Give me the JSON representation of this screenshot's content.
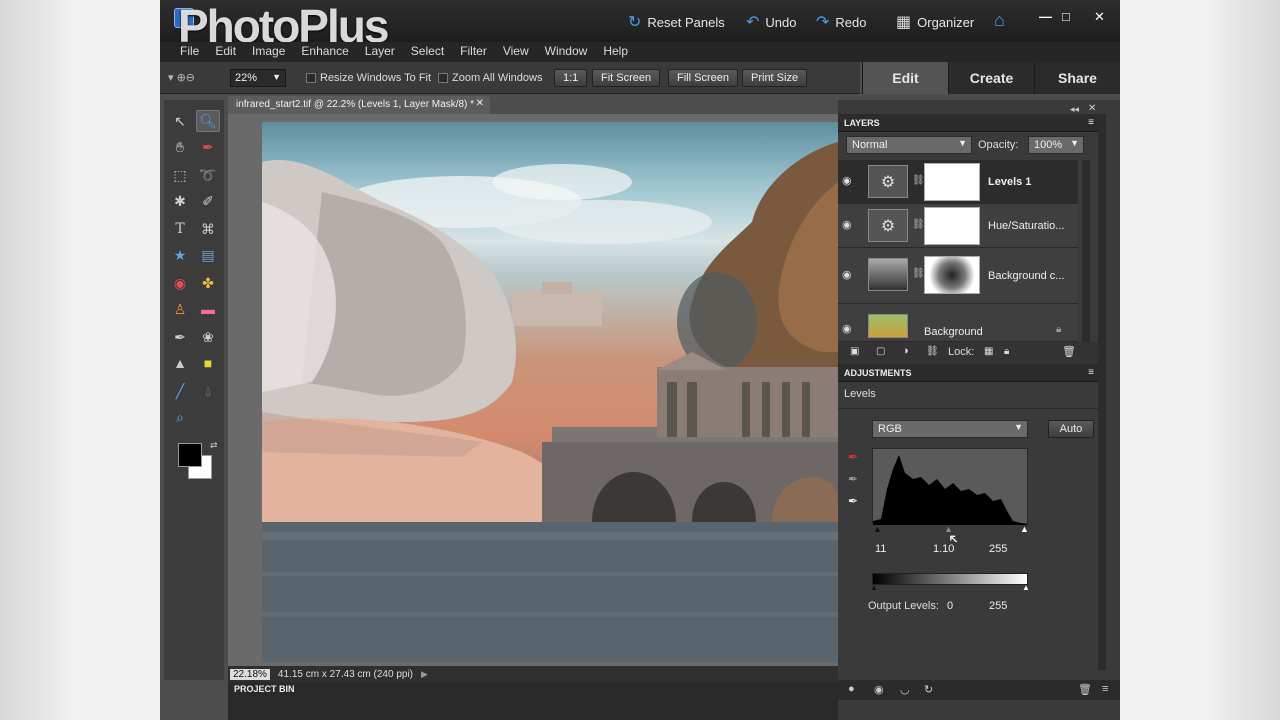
{
  "app": {
    "title": "PhotoPlus"
  },
  "titlebar": {
    "reset_panels": "Reset Panels",
    "undo": "Undo",
    "redo": "Redo",
    "organizer": "Organizer"
  },
  "menu": [
    "File",
    "Edit",
    "Image",
    "Enhance",
    "Layer",
    "Select",
    "Filter",
    "View",
    "Window",
    "Help"
  ],
  "options": {
    "zoom_value": "22%",
    "resize_windows": "Resize Windows To Fit",
    "zoom_all": "Zoom All Windows",
    "one_to_one": "1:1",
    "fit_screen": "Fit Screen",
    "fill_screen": "Fill Screen",
    "print_size": "Print Size"
  },
  "mode_tabs": [
    "Edit",
    "Create",
    "Share"
  ],
  "document": {
    "tab_title": "infrared_start2.tif @ 22.2% (Levels 1, Layer Mask/8) *",
    "status_zoom": "22.18%",
    "status_info": "41.15 cm x 27.43 cm (240 ppi)"
  },
  "project_bin": "PROJECT BIN",
  "layers_panel": {
    "title": "LAYERS",
    "blend_mode": "Normal",
    "opacity_label": "Opacity:",
    "opacity_value": "100%",
    "lock_label": "Lock:",
    "layers": [
      {
        "name": "Levels 1",
        "active": true
      },
      {
        "name": "Hue/Saturatio...",
        "active": false
      },
      {
        "name": "Background c...",
        "active": false
      },
      {
        "name": "Background",
        "active": false
      }
    ]
  },
  "adjustments_panel": {
    "title": "ADJUSTMENTS",
    "type": "Levels",
    "channel": "RGB",
    "auto_label": "Auto",
    "input_black": "11",
    "input_gamma": "1.10",
    "input_white": "255",
    "output_label": "Output Levels:",
    "output_black": "0",
    "output_white": "255"
  }
}
